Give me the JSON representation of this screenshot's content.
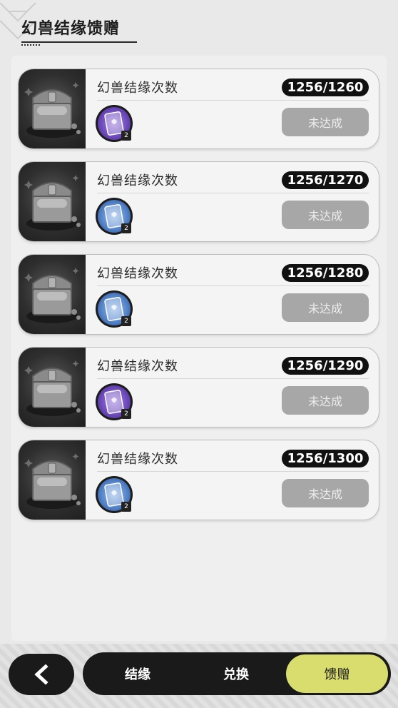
{
  "header": {
    "title": "幻兽结缘馈赠"
  },
  "cards": [
    {
      "title": "幻兽结缘次数",
      "progress": "1256/1260",
      "button": "未达成",
      "reward": {
        "icon": "purple-card-icon",
        "color": "purple",
        "count": "2"
      }
    },
    {
      "title": "幻兽结缘次数",
      "progress": "1256/1270",
      "button": "未达成",
      "reward": {
        "icon": "blue-card-icon",
        "color": "blue",
        "count": "2"
      }
    },
    {
      "title": "幻兽结缘次数",
      "progress": "1256/1280",
      "button": "未达成",
      "reward": {
        "icon": "blue-card-icon",
        "color": "blue",
        "count": "2"
      }
    },
    {
      "title": "幻兽结缘次数",
      "progress": "1256/1290",
      "button": "未达成",
      "reward": {
        "icon": "purple-card-icon",
        "color": "purple",
        "count": "2"
      }
    },
    {
      "title": "幻兽结缘次数",
      "progress": "1256/1300",
      "button": "未达成",
      "reward": {
        "icon": "blue-card-icon",
        "color": "blue",
        "count": "2"
      }
    }
  ],
  "tabs": [
    {
      "label": "结缘",
      "active": false
    },
    {
      "label": "兑换",
      "active": false
    },
    {
      "label": "馈赠",
      "active": true
    }
  ],
  "colors": {
    "accent": "#d8dd6d",
    "dark": "#1a1a1a",
    "disabled_button": "#a7a7a7"
  }
}
